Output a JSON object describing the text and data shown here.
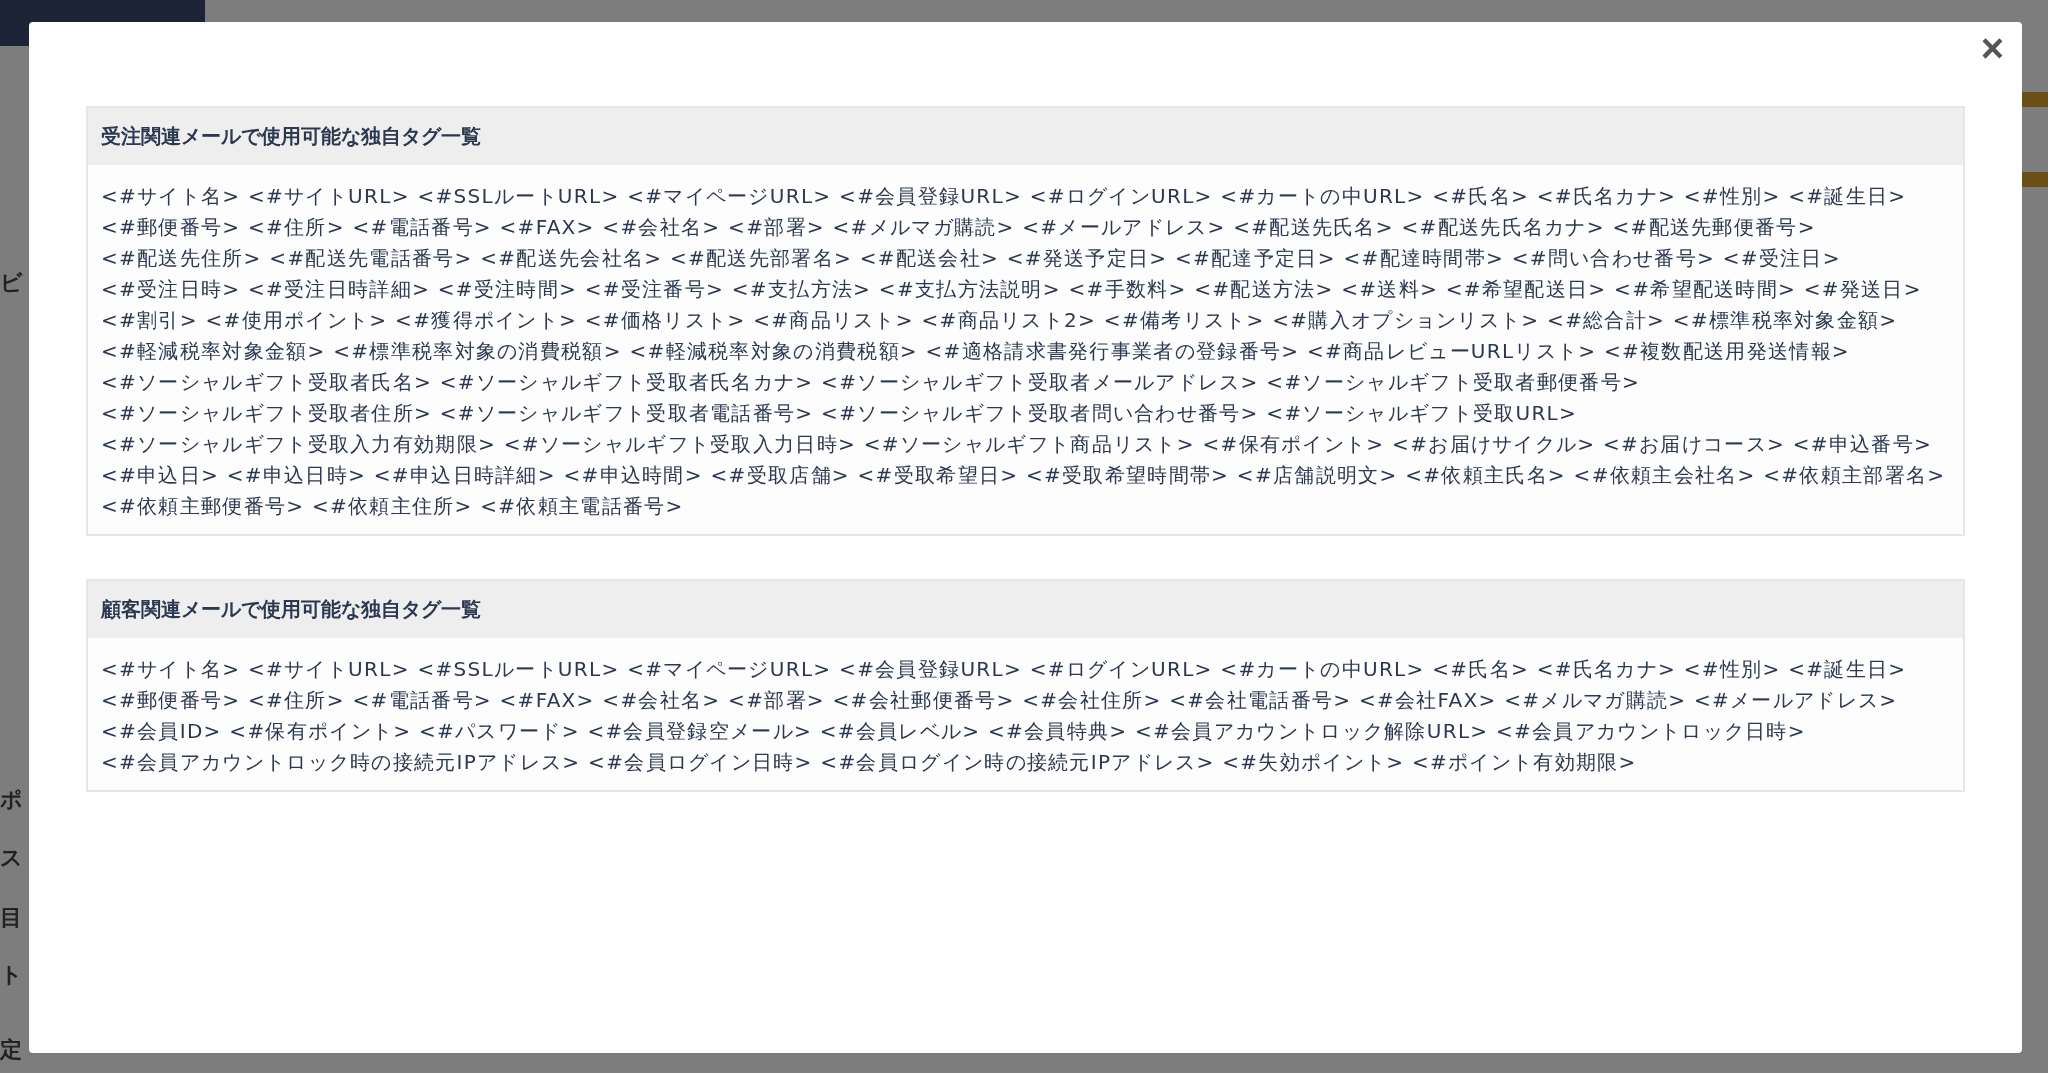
{
  "backdrop": {
    "sidebar_fragments": [
      "ビ",
      "ポ",
      "ス",
      "目",
      "ト",
      "定"
    ]
  },
  "modal": {
    "close": "×",
    "sections": [
      {
        "title": "受注関連メールで使用可能な独自タグ一覧",
        "tags": [
          "<#サイト名>",
          "<#サイトURL>",
          "<#SSLルートURL>",
          "<#マイページURL>",
          "<#会員登録URL>",
          "<#ログインURL>",
          "<#カートの中URL>",
          "<#氏名>",
          "<#氏名カナ>",
          "<#性別>",
          "<#誕生日>",
          "<#郵便番号>",
          "<#住所>",
          "<#電話番号>",
          "<#FAX>",
          "<#会社名>",
          "<#部署>",
          "<#メルマガ購読>",
          "<#メールアドレス>",
          "<#配送先氏名>",
          "<#配送先氏名カナ>",
          "<#配送先郵便番号>",
          "<#配送先住所>",
          "<#配送先電話番号>",
          "<#配送先会社名>",
          "<#配送先部署名>",
          "<#配送会社>",
          "<#発送予定日>",
          "<#配達予定日>",
          "<#配達時間帯>",
          "<#問い合わせ番号>",
          "<#受注日>",
          "<#受注日時>",
          "<#受注日時詳細>",
          "<#受注時間>",
          "<#受注番号>",
          "<#支払方法>",
          "<#支払方法説明>",
          "<#手数料>",
          "<#配送方法>",
          "<#送料>",
          "<#希望配送日>",
          "<#希望配送時間>",
          "<#発送日>",
          "<#割引>",
          "<#使用ポイント>",
          "<#獲得ポイント>",
          "<#価格リスト>",
          "<#商品リスト>",
          "<#商品リスト2>",
          "<#備考リスト>",
          "<#購入オプションリスト>",
          "<#総合計>",
          "<#標準税率対象金額>",
          "<#軽減税率対象金額>",
          "<#標準税率対象の消費税額>",
          "<#軽減税率対象の消費税額>",
          "<#適格請求書発行事業者の登録番号>",
          "<#商品レビューURLリスト>",
          "<#複数配送用発送情報>",
          "<#ソーシャルギフト受取者氏名>",
          "<#ソーシャルギフト受取者氏名カナ>",
          "<#ソーシャルギフト受取者メールアドレス>",
          "<#ソーシャルギフト受取者郵便番号>",
          "<#ソーシャルギフト受取者住所>",
          "<#ソーシャルギフト受取者電話番号>",
          "<#ソーシャルギフト受取者問い合わせ番号>",
          "<#ソーシャルギフト受取URL>",
          "<#ソーシャルギフト受取入力有効期限>",
          "<#ソーシャルギフト受取入力日時>",
          "<#ソーシャルギフト商品リスト>",
          "<#保有ポイント>",
          "<#お届けサイクル>",
          "<#お届けコース>",
          "<#申込番号>",
          "<#申込日>",
          "<#申込日時>",
          "<#申込日時詳細>",
          "<#申込時間>",
          "<#受取店舗>",
          "<#受取希望日>",
          "<#受取希望時間帯>",
          "<#店舗説明文>",
          "<#依頼主氏名>",
          "<#依頼主会社名>",
          "<#依頼主部署名>",
          "<#依頼主郵便番号>",
          "<#依頼主住所>",
          "<#依頼主電話番号>"
        ]
      },
      {
        "title": "顧客関連メールで使用可能な独自タグ一覧",
        "tags": [
          "<#サイト名>",
          "<#サイトURL>",
          "<#SSLルートURL>",
          "<#マイページURL>",
          "<#会員登録URL>",
          "<#ログインURL>",
          "<#カートの中URL>",
          "<#氏名>",
          "<#氏名カナ>",
          "<#性別>",
          "<#誕生日>",
          "<#郵便番号>",
          "<#住所>",
          "<#電話番号>",
          "<#FAX>",
          "<#会社名>",
          "<#部署>",
          "<#会社郵便番号>",
          "<#会社住所>",
          "<#会社電話番号>",
          "<#会社FAX>",
          "<#メルマガ購読>",
          "<#メールアドレス>",
          "<#会員ID>",
          "<#保有ポイント>",
          "<#パスワード>",
          "<#会員登録空メール>",
          "<#会員レベル>",
          "<#会員特典>",
          "<#会員アカウントロック解除URL>",
          "<#会員アカウントロック日時>",
          "<#会員アカウントロック時の接続元IPアドレス>",
          "<#会員ログイン日時>",
          "<#会員ログイン時の接続元IPアドレス>",
          "<#失効ポイント>",
          "<#ポイント有効期限>"
        ]
      }
    ]
  }
}
